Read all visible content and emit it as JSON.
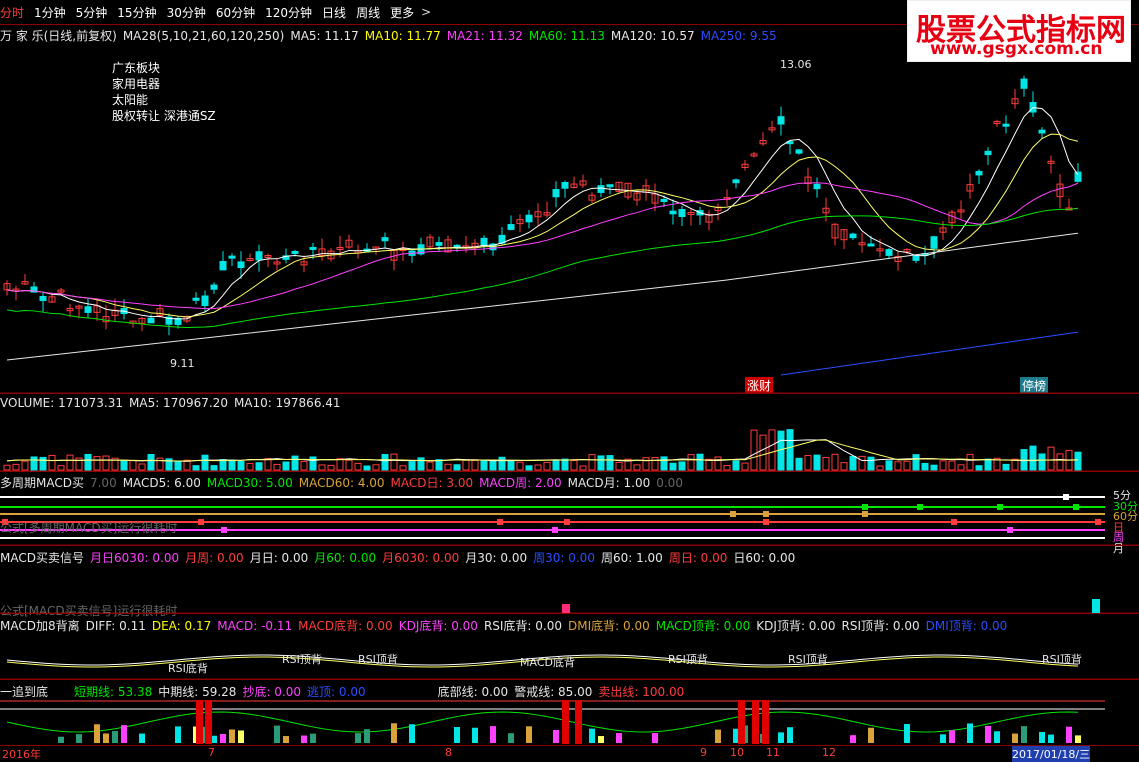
{
  "toolbar": {
    "items": [
      "分时",
      "1分钟",
      "5分钟",
      "15分钟",
      "30分钟",
      "60分钟",
      "120分钟",
      "日线",
      "周线",
      "更多"
    ],
    "arrow": ">"
  },
  "watermark": {
    "title": "股票公式指标网",
    "url": "www.gsgx.com.cn"
  },
  "price_panel": {
    "stock_name": "万 家 乐(日线,前复权)",
    "ma_params": "MA28(5,10,21,60,120,250)",
    "ma5": "MA5: 11.17",
    "ma10": "MA10: 11.77",
    "ma21": "MA21: 11.32",
    "ma60": "MA60: 11.13",
    "ma120": "MA120: 10.57",
    "ma250": "MA250: 9.55",
    "sectors": [
      "广东板块",
      "家用电器",
      "太阳能",
      "股权转让 深港通SZ"
    ],
    "high_label": "13.06",
    "low_label": "9.11",
    "tag_zc": "涨财",
    "tag_tp": "停榜"
  },
  "volume_panel": {
    "volume": "VOLUME: 171073.31",
    "ma5": "MA5: 170967.20",
    "ma10": "MA10: 197866.41"
  },
  "macd_multi": {
    "title": "多周期MACD买",
    "dim_val": "7.00",
    "macd5": "MACD5: 6.00",
    "macd30": "MACD30: 5.00",
    "macd60": "MACD60: 4.00",
    "macd_day": "MACD日: 3.00",
    "macd_week": "MACD周: 2.00",
    "macd_month": "MACD月: 1.00",
    "dim_val2": "0.00",
    "note": "公式[多周期MACD买]运行很耗时",
    "right_labels": [
      "5分",
      "30分",
      "60分",
      "日",
      "周",
      "月"
    ]
  },
  "macd_signal": {
    "title": "MACD买卖信号",
    "items": [
      "月日6030: 0.00",
      "月周: 0.00",
      "月日: 0.00",
      "月60: 0.00",
      "月6030: 0.00",
      "月30: 0.00",
      "周30: 0.00",
      "周60: 1.00",
      "周日: 0.00",
      "日60: 0.00"
    ],
    "note": "公式[MACD买卖信号]运行很耗时"
  },
  "macd_div": {
    "title": "MACD加8背离",
    "diff": "DIFF: 0.11",
    "dea": "DEA: 0.17",
    "macd": "MACD: -0.11",
    "items": [
      "MACD底背: 0.00",
      "KDJ底背: 0.00",
      "RSI底背: 0.00",
      "DMI底背: 0.00",
      "MACD顶背: 0.00",
      "KDJ顶背: 0.00",
      "RSI顶背: 0.00",
      "DMI顶背: 0.00"
    ],
    "labels": [
      "RSI底背",
      "RSI顶背",
      "RSI顶背",
      "MACD底背",
      "RSI顶背",
      "RSI顶背",
      "RSI顶背"
    ]
  },
  "bottom_panel": {
    "title": "一追到底",
    "short": "短期线: 53.38",
    "mid": "中期线: 59.28",
    "chaodi": "抄底: 0.00",
    "taoding": "逃顶: 0.00",
    "bottom": "底部线: 0.00",
    "alert": "警戒线: 85.00",
    "sell": "卖出线: 100.00"
  },
  "xaxis": {
    "labels": [
      "2016年",
      "7",
      "8",
      "9",
      "10",
      "11",
      "12",
      "2017/01/18/三"
    ]
  }
}
